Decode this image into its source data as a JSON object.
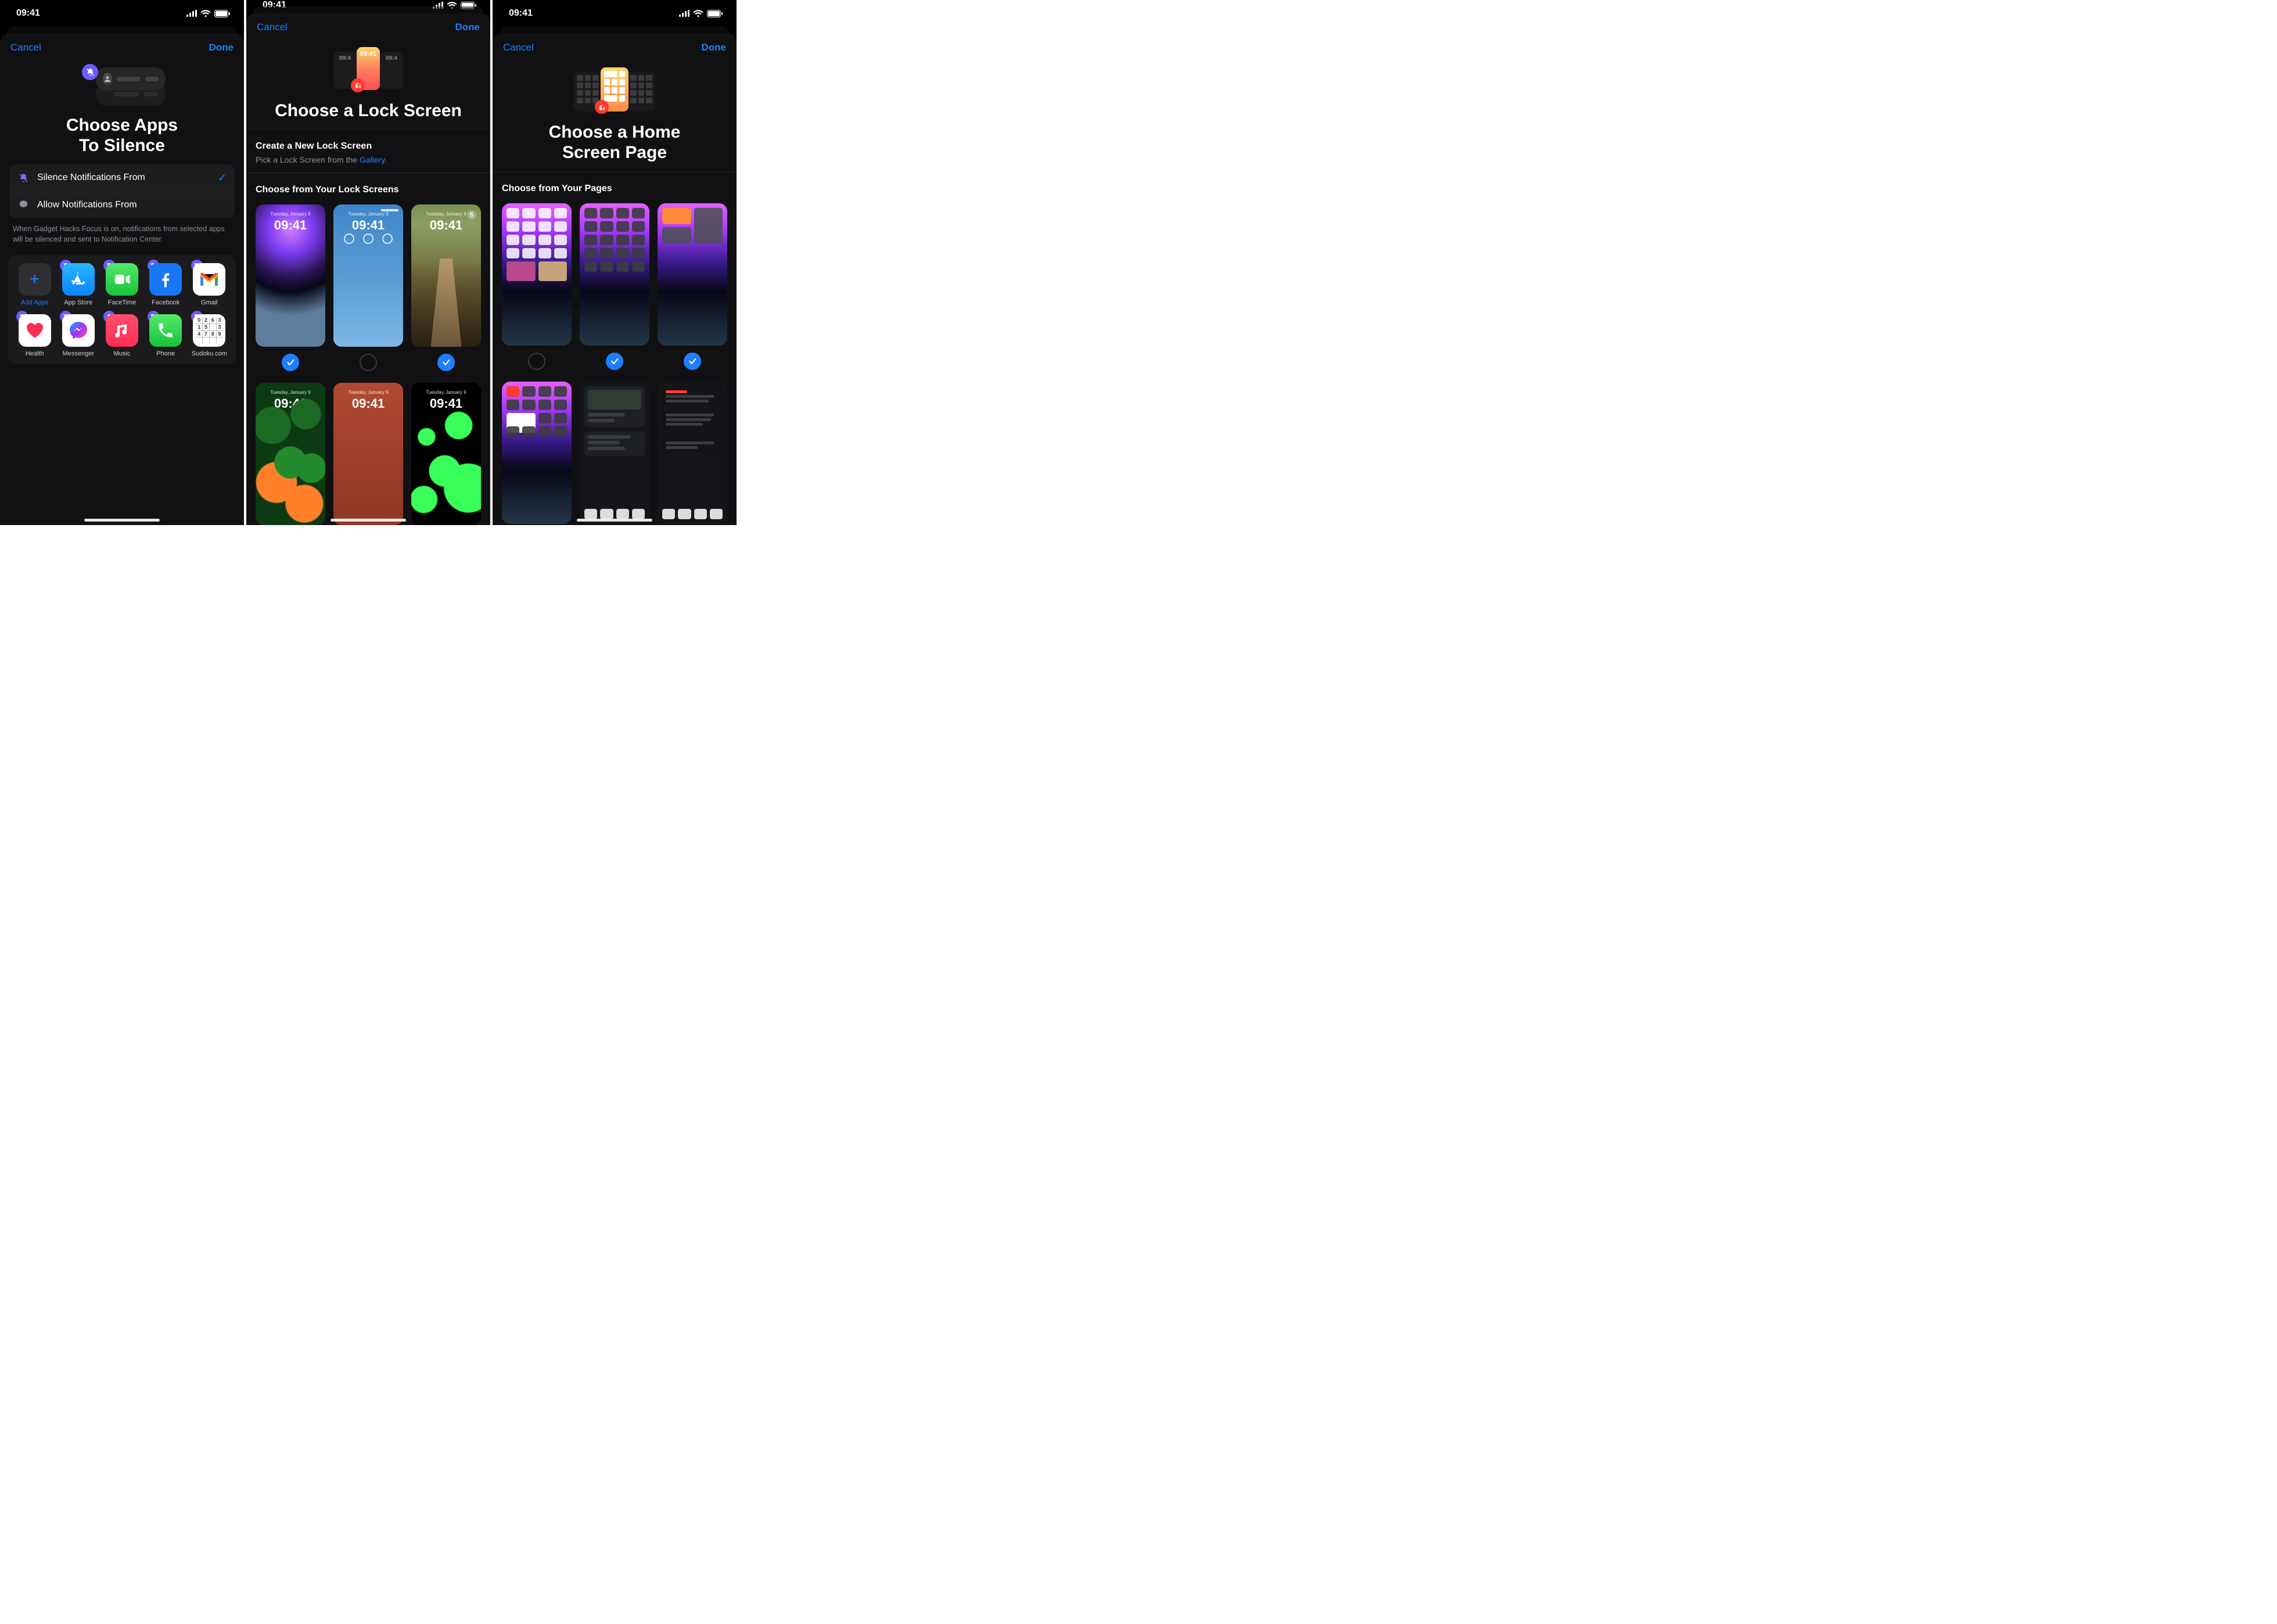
{
  "status": {
    "time": "09:41"
  },
  "nav": {
    "cancel": "Cancel",
    "done": "Done"
  },
  "p1": {
    "title_line1": "Choose Apps",
    "title_line2": "To Silence",
    "opt_silence": "Silence Notifications From",
    "opt_allow": "Allow Notifications From",
    "hint": "When Gadget Hacks Focus is on, notifications from selected apps will be silenced and sent to Notification Center.",
    "add_label": "Add Apps",
    "apps": {
      "appstore": "App Store",
      "facetime": "FaceTime",
      "facebook": "Facebook",
      "gmail": "Gmail",
      "health": "Health",
      "messenger": "Messenger",
      "music": "Music",
      "phone": "Phone",
      "sudoku": "Sudoku.com"
    }
  },
  "p2": {
    "hero_mini_time": "09:4",
    "hero_main_time": "09:41",
    "title": "Choose a Lock Screen",
    "create_label": "Create a New Lock Screen",
    "create_sub_pre": "Pick a Lock Screen from the ",
    "create_link": "Gallery",
    "choose_label": "Choose from Your Lock Screens",
    "ls_date": "Tuesday, January 9",
    "ls_time": "09:41"
  },
  "p3": {
    "title_line1": "Choose a Home",
    "title_line2": "Screen Page",
    "choose_label": "Choose from Your Pages"
  }
}
